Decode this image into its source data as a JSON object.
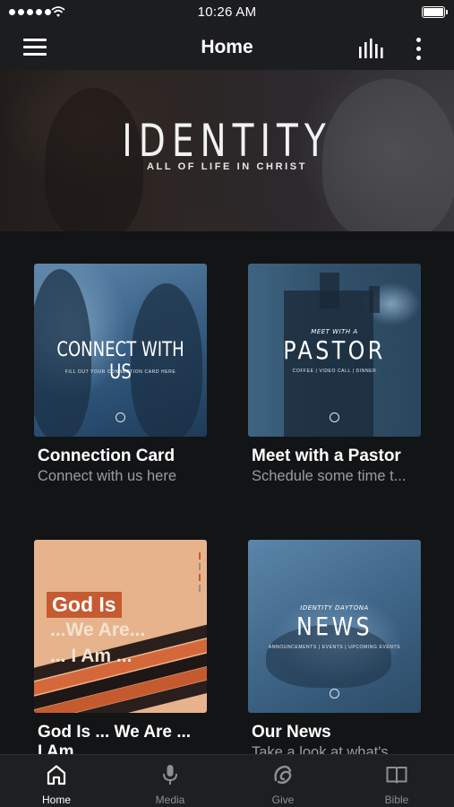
{
  "status_bar": {
    "time": "10:26 AM"
  },
  "nav": {
    "title": "Home"
  },
  "hero": {
    "title": "IDENTITY",
    "subtitle": "ALL OF LIFE IN CHRIST"
  },
  "cards": [
    {
      "title": "Connection Card",
      "subtitle": "Connect with us here",
      "image_text": "CONNECT WITH US",
      "image_caption": "FILL OUT YOUR CONNECTION CARD HERE"
    },
    {
      "title": "Meet with a Pastor",
      "subtitle": "Schedule some time t...",
      "image_kicker": "MEET WITH A",
      "image_text": "PASTOR",
      "image_caption": "COFFEE | VIDEO CALL | DINNER"
    },
    {
      "title": "God Is ... We Are ...",
      "title_line2": "I Am ...",
      "subtitle": "",
      "image_lines": [
        "God Is",
        "...We Are...",
        "... I Am ..."
      ]
    },
    {
      "title": "Our News",
      "subtitle": "Take a look at what's...",
      "image_kicker": "IDENTITY DAYTONA",
      "image_text": "NEWS",
      "image_caption": "ANNOUNCEMENTS | EVENTS | UPCOMING EVENTS"
    }
  ],
  "tabs": [
    {
      "label": "Home",
      "icon": "home-icon",
      "active": true
    },
    {
      "label": "Media",
      "icon": "microphone-icon",
      "active": false
    },
    {
      "label": "Give",
      "icon": "give-icon",
      "active": false
    },
    {
      "label": "Bible",
      "icon": "book-icon",
      "active": false
    }
  ],
  "colors": {
    "background": "#131416",
    "bar": "#1c1d1f",
    "muted_text": "#9b9ca0",
    "accent": "#c65a31"
  }
}
